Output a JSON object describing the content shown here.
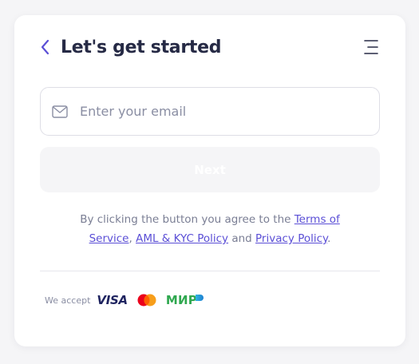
{
  "header": {
    "title": "Let's get started"
  },
  "email": {
    "value": "",
    "placeholder": "Enter your email"
  },
  "next_button": {
    "label": "Next"
  },
  "terms": {
    "prefix": "By clicking the button you agree to the ",
    "terms_link": "Terms of Service",
    "separator": ", ",
    "aml_link": "AML & KYC Policy",
    "and_text": " and ",
    "privacy_link": "Privacy Policy",
    "suffix": "."
  },
  "payments": {
    "label": "We accept",
    "visa": "VISA",
    "mir": "МИР"
  },
  "colors": {
    "accent": "#5b4fd6",
    "title": "#262a45",
    "muted": "#8a8ea3"
  },
  "icons": [
    "back-icon",
    "menu-icon",
    "mail-icon",
    "mastercard-icon"
  ]
}
